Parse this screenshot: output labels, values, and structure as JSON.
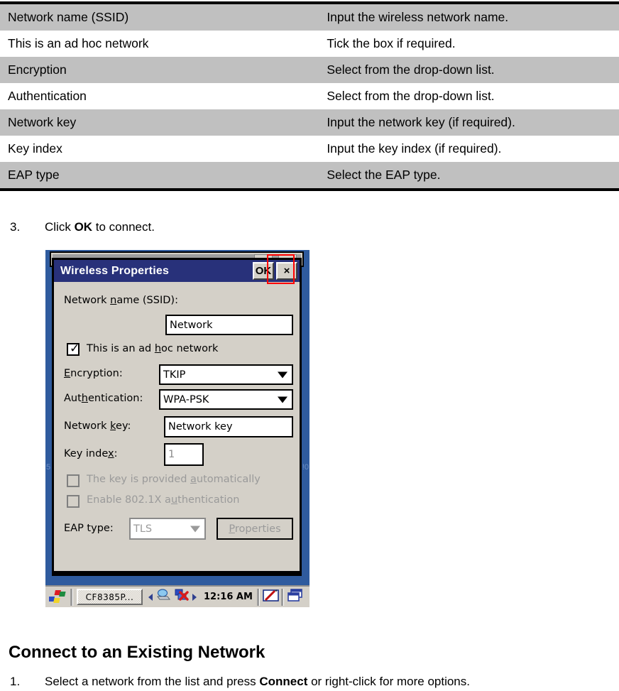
{
  "reference_table": {
    "rows": [
      {
        "term": "Network name (SSID)",
        "description": "Input the wireless network name.",
        "shaded": true
      },
      {
        "term": "This is an ad hoc network",
        "description": "Tick the box if required.",
        "shaded": false
      },
      {
        "term": "Encryption",
        "description": "Select from the drop-down list.",
        "shaded": true
      },
      {
        "term": "Authentication",
        "description": "Select from the drop-down list.",
        "shaded": false
      },
      {
        "term": "Network key",
        "description": "Input the network key (if required).",
        "shaded": true
      },
      {
        "term": "Key index",
        "description": "Input the key index (if required).",
        "shaded": false
      },
      {
        "term": "EAP type",
        "description": "Select the EAP type.",
        "shaded": true
      }
    ]
  },
  "step3": {
    "number": "3.",
    "text_before": "Click ",
    "emphasis": "OK",
    "text_after": " to connect."
  },
  "dialog": {
    "title": "Wireless Properties",
    "ok_label": "OK",
    "close_label": "×",
    "ssid_label": "Network name (SSID):",
    "ssid_value": "Network",
    "adhoc_label": "This is an ad hoc network",
    "adhoc_checked": true,
    "encryption_label": "Encryption:",
    "encryption_value": "TKIP",
    "authentication_label": "Authentication:",
    "authentication_value": "WPA-PSK",
    "network_key_label": "Network key:",
    "network_key_value": "Network key",
    "key_index_label": "Key index:",
    "key_index_value": "1",
    "auto_key_label": "The key is provided automatically",
    "auto_key_checked": false,
    "dot1x_label": "Enable 802.1X authentication",
    "dot1x_checked": false,
    "eap_type_label": "EAP type:",
    "eap_type_value": "TLS",
    "properties_label": "Properties",
    "desktop_text_left": "5",
    "desktop_text_right": "!0"
  },
  "taskbar": {
    "task_button_label": "CF8385P...",
    "clock": "12:16 AM"
  },
  "section": {
    "heading": "Connect to an Existing Network",
    "step1_number": "1.",
    "step1_before": "Select a network from the list and press ",
    "step1_emphasis": "Connect",
    "step1_after": " or right-click for more options."
  },
  "colors": {
    "table_shade": "#c0c0c0",
    "titlebar": "#28317a",
    "dialog_face": "#d4d0c8",
    "desktop": "#2f5b9e",
    "highlight": "#ff0000"
  }
}
